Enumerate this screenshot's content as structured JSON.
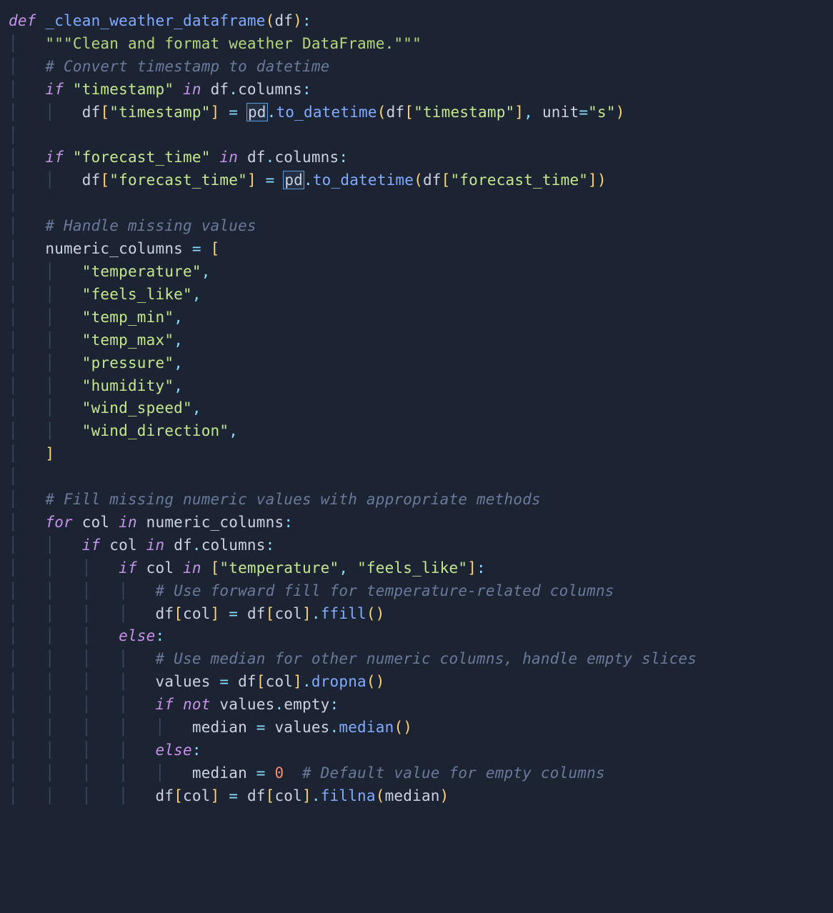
{
  "code": {
    "lang": "python",
    "func_name": "_clean_weather_dataframe",
    "param": "df",
    "docstring": "Clean and format weather DataFrame.",
    "comments": {
      "c1": "# Convert timestamp to datetime",
      "c2": "# Handle missing values",
      "c3": "# Fill missing numeric values with appropriate methods",
      "c4": "# Use forward fill for temperature-related columns",
      "c5": "# Use median for other numeric columns, handle empty slices",
      "c6": "# Default value for empty columns"
    },
    "keywords": {
      "def": "def",
      "if": "if",
      "in": "in",
      "for": "for",
      "not": "not",
      "else": "else"
    },
    "idents": {
      "df": "df",
      "pd": "pd",
      "columns": "columns",
      "numeric_columns": "numeric_columns",
      "col": "col",
      "values": "values",
      "median": "median",
      "empty": "empty",
      "unit": "unit"
    },
    "calls": {
      "to_datetime": "to_datetime",
      "ffill": "ffill",
      "dropna": "dropna",
      "median": "median",
      "fillna": "fillna"
    },
    "strings": {
      "timestamp": "\"timestamp\"",
      "forecast_time": "\"forecast_time\"",
      "temperature": "\"temperature\"",
      "feels_like": "\"feels_like\"",
      "temp_min": "\"temp_min\"",
      "temp_max": "\"temp_max\"",
      "pressure": "\"pressure\"",
      "humidity": "\"humidity\"",
      "wind_speed": "\"wind_speed\"",
      "wind_direction": "\"wind_direction\"",
      "s": "\"s\"",
      "tq": "\"\"\""
    },
    "nums": {
      "zero": "0"
    }
  }
}
